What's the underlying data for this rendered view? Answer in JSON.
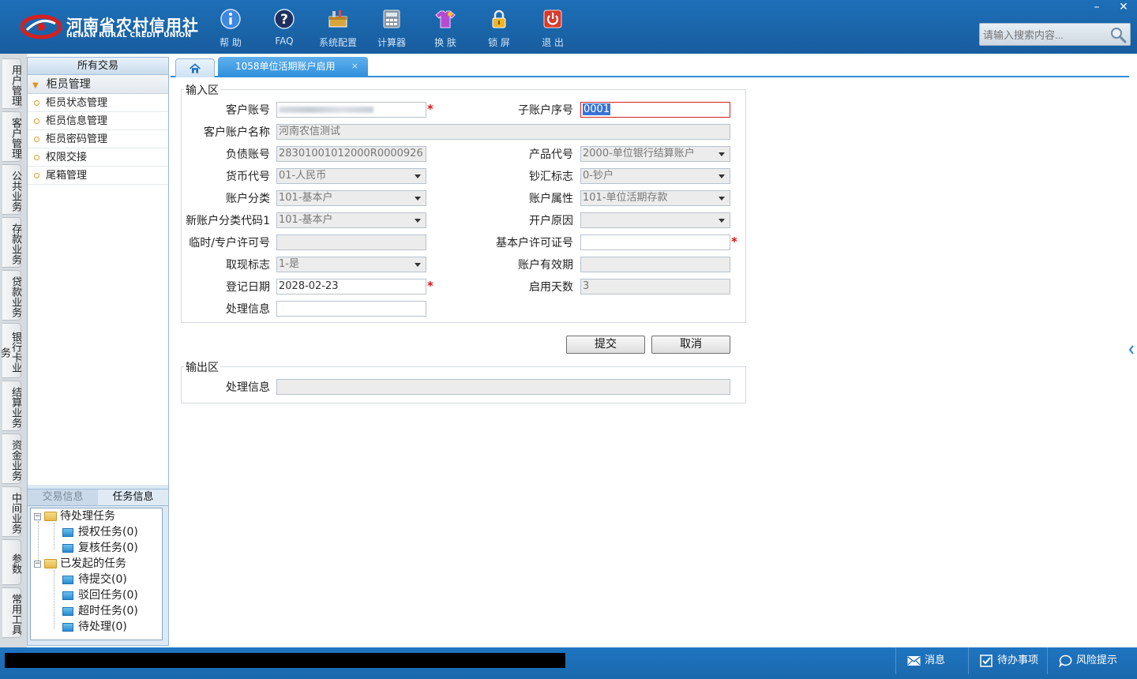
{
  "header": {
    "logo_cn": "河南省农村信用社",
    "logo_en": "HENAN RURAL CREDIT UNION",
    "search_placeholder": "请输入搜索内容...",
    "minimize": "–",
    "close": "✕"
  },
  "toolbar": [
    {
      "label": "帮 助",
      "icon": "info-icon"
    },
    {
      "label": "FAQ",
      "icon": "question-icon"
    },
    {
      "label": "系统配置",
      "icon": "toolbox-icon"
    },
    {
      "label": "计算器",
      "icon": "calculator-icon"
    },
    {
      "label": "换 肤",
      "icon": "shirt-icon"
    },
    {
      "label": "锁 屏",
      "icon": "lock-icon"
    },
    {
      "label": "退 出",
      "icon": "power-icon"
    }
  ],
  "categories": [
    "用户管理",
    "客户管理",
    "公共业务",
    "存款业务",
    "贷款业务",
    "银行卡业务",
    "结算业务",
    "资金业务",
    "中间业务",
    "参数",
    "常用工具"
  ],
  "left_panel": {
    "title": "所有交易",
    "group": "柜员管理",
    "items": [
      "柜员状态管理",
      "柜员信息管理",
      "柜员密码管理",
      "权限交接",
      "尾箱管理"
    ],
    "tabs": {
      "trade_info": "交易信息",
      "task_info": "任务信息"
    },
    "tree": {
      "pending": "待处理任务",
      "auth": "授权任务(0)",
      "review": "复核任务(0)",
      "initiated": "已发起的任务",
      "to_submit": "待提交(0)",
      "rejected": "驳回任务(0)",
      "timeout": "超时任务(0)",
      "to_handle": "待处理(0)"
    }
  },
  "tabs": {
    "doc_tab": "1058单位活期账户启用",
    "close": "×"
  },
  "form": {
    "input_section": "输入区",
    "output_section": "输出区",
    "labels": {
      "customer_account": "客户账号",
      "sub_account_no": "子账户序号",
      "customer_account_name": "客户账户名称",
      "liability_account": "负债账号",
      "product_code": "产品代号",
      "currency_code": "货币代号",
      "cash_flag": "钞汇标志",
      "account_category": "账户分类",
      "account_attribute": "账户属性",
      "new_account_category_code": "新账户分类代码1",
      "open_reason": "开户原因",
      "temp_permit_no": "临时/专户许可号",
      "basic_permit_no": "基本户许可证号",
      "withdraw_flag": "取现标志",
      "account_validity": "账户有效期",
      "register_date": "登记日期",
      "enable_days": "启用天数",
      "process_info": "处理信息",
      "output_process_info": "处理信息"
    },
    "values": {
      "sub_account_no": "0001",
      "customer_account_name": "河南农信测试",
      "liability_account": "28301001012000R0000926",
      "product_code": "2000-单位银行结算账户",
      "currency_code": "01-人民币",
      "cash_flag": "0-钞户",
      "account_category": "101-基本户",
      "account_attribute": "101-单位活期存款",
      "new_account_category_code": "101-基本户",
      "withdraw_flag": "1-是",
      "register_date": "2028-02-23",
      "enable_days": "3"
    },
    "required_mark": "*",
    "submit": "提交",
    "cancel": "取消"
  },
  "statusbar": {
    "message": "消息",
    "todo": "待办事项",
    "risk": "风险提示"
  },
  "colors": {
    "header_blue": "#1a64a8",
    "tab_active": "#2f8fdc",
    "required_red": "#d11111"
  }
}
